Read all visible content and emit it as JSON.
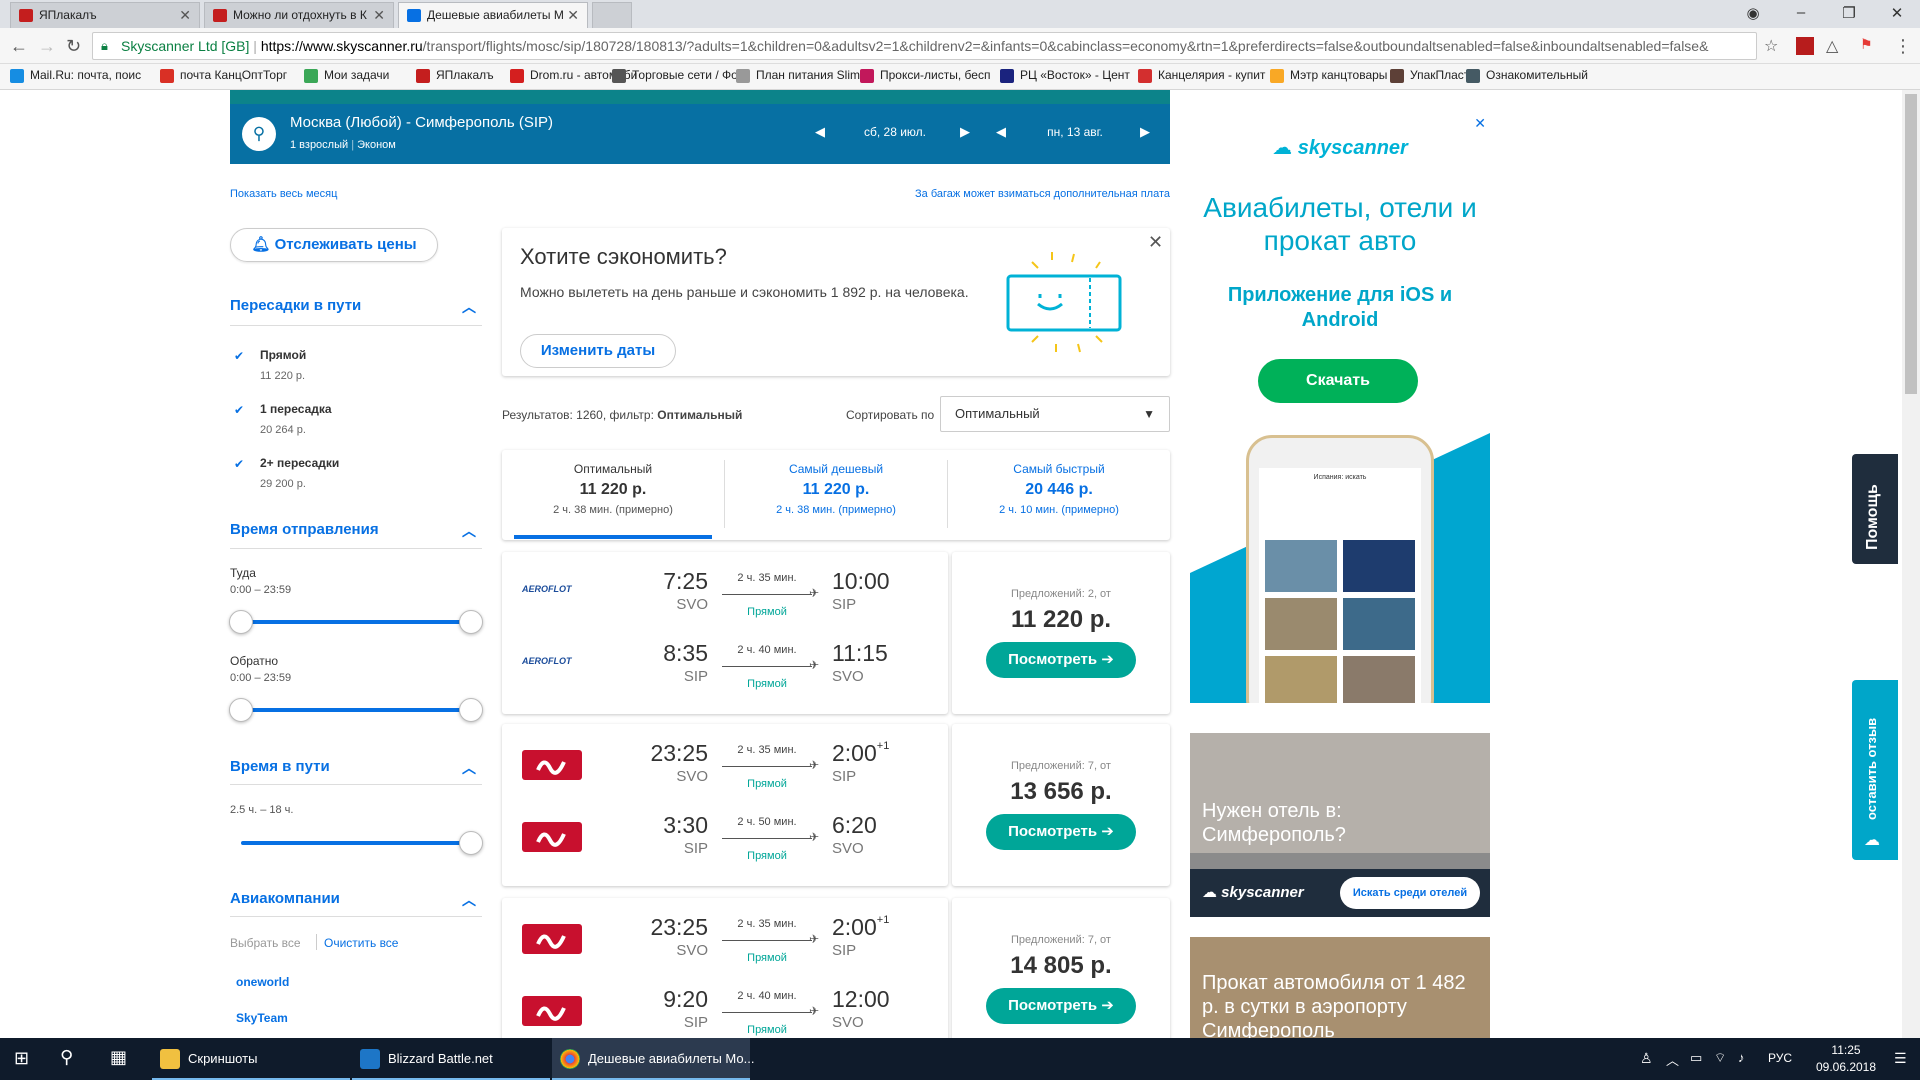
{
  "browser": {
    "tabs": [
      {
        "label": "ЯПлакалъ"
      },
      {
        "label": "Можно ли отдохнуть в К"
      },
      {
        "label": "Дешевые авиабилеты М"
      }
    ],
    "security_label": "Skyscanner Ltd [GB]",
    "url_domain": "https://www.skyscanner.ru",
    "url_path": "/transport/flights/mosc/sip/180728/180813/?adults=1&children=0&adultsv2=1&childrenv2=&infants=0&cabinclass=economy&rtn=1&preferdirects=false&outboundaltsenabled=false&inboundaltsenabled=false&",
    "bookmarks": [
      {
        "label": "Mail.Ru: почта, поис",
        "color": "#168de2"
      },
      {
        "label": "почта КанцОптТорг",
        "color": "#d93025"
      },
      {
        "label": "Мои задачи",
        "color": "#3aa757"
      },
      {
        "label": "ЯПлакалъ",
        "color": "#c41e1e"
      },
      {
        "label": "Drom.ru - автомоби",
        "color": "#d41f1f"
      },
      {
        "label": "Торговые сети / Фо",
        "color": "#555555"
      },
      {
        "label": "План питания Slim",
        "color": "#999999"
      },
      {
        "label": "Прокси-листы, бесп",
        "color": "#c2185b"
      },
      {
        "label": "РЦ «Восток» - Цент",
        "color": "#1a237e"
      },
      {
        "label": "Канцелярия - купит",
        "color": "#d32f2f"
      },
      {
        "label": "Мэтр канцтовары",
        "color": "#f9a825"
      },
      {
        "label": "УпакПласт",
        "color": "#5d4037"
      },
      {
        "label": "Ознакомительный",
        "color": "#455a64"
      }
    ]
  },
  "search": {
    "route": "Москва (Любой) - Симферополь (SIP)",
    "passengers": "1 взрослый",
    "cabin": "Эконом",
    "date_out": "сб, 28 июл.",
    "date_back": "пн, 13 авг.",
    "show_month": "Показать весь месяц",
    "baggage_note": "За багаж может взиматься дополнительная плата"
  },
  "filters": {
    "track_prices": "Отслеживать цены",
    "stops_title": "Пересадки в пути",
    "stops": [
      {
        "label": "Прямой",
        "price": "11 220 р."
      },
      {
        "label": "1 пересадка",
        "price": "20 264 р."
      },
      {
        "label": "2+ пересадки",
        "price": "29 200 р."
      }
    ],
    "departure_title": "Время отправления",
    "outbound_label": "Туда",
    "outbound_range": "0:00 – 23:59",
    "inbound_label": "Обратно",
    "inbound_range": "0:00 – 23:59",
    "duration_title": "Время в пути",
    "duration_range": "2.5 ч. – 18 ч.",
    "airlines_title": "Авиакомпании",
    "select_all": "Выбрать все",
    "clear_all": "Очистить все",
    "alliances": [
      "oneworld",
      "SkyTeam"
    ]
  },
  "promo": {
    "title": "Хотите сэкономить?",
    "text": "Можно вылететь на день раньше и сэкономить 1 892 р. на человека.",
    "button": "Изменить даты"
  },
  "results": {
    "count_prefix": "Результатов: 1260, фильтр: ",
    "count_filter": "Оптимальный",
    "sort_label": "Сортировать по",
    "sort_value": "Оптимальный",
    "tabs": [
      {
        "title": "Оптимальный",
        "price": "11 220 р.",
        "duration": "2 ч. 38 мин. (примерно)"
      },
      {
        "title": "Самый дешевый",
        "price": "11 220 р.",
        "duration": "2 ч. 38 мин. (примерно)"
      },
      {
        "title": "Самый быстрый",
        "price": "20 446 р.",
        "duration": "2 ч. 10 мин. (примерно)"
      }
    ],
    "flights": [
      {
        "airline": "AEROFLOT",
        "offers": "Предложений: 2, от",
        "price": "11 220 р.",
        "button": "Посмотреть",
        "legs": [
          {
            "dep": "7:25",
            "dep_apt": "SVO",
            "dur": "2 ч. 35 мин.",
            "type": "Прямой",
            "arr": "10:00",
            "arr_apt": "SIP",
            "plus": ""
          },
          {
            "dep": "8:35",
            "dep_apt": "SIP",
            "dur": "2 ч. 40 мин.",
            "type": "Прямой",
            "arr": "11:15",
            "arr_apt": "SVO",
            "plus": ""
          }
        ]
      },
      {
        "airline": "S7",
        "offers": "Предложений: 7, от",
        "price": "13 656 р.",
        "button": "Посмотреть",
        "legs": [
          {
            "dep": "23:25",
            "dep_apt": "SVO",
            "dur": "2 ч. 35 мин.",
            "type": "Прямой",
            "arr": "2:00",
            "arr_apt": "SIP",
            "plus": "+1"
          },
          {
            "dep": "3:30",
            "dep_apt": "SIP",
            "dur": "2 ч. 50 мин.",
            "type": "Прямой",
            "arr": "6:20",
            "arr_apt": "SVO",
            "plus": ""
          }
        ]
      },
      {
        "airline": "S7",
        "offers": "Предложений: 7, от",
        "price": "14 805 р.",
        "button": "Посмотреть",
        "legs": [
          {
            "dep": "23:25",
            "dep_apt": "SVO",
            "dur": "2 ч. 35 мин.",
            "type": "Прямой",
            "arr": "2:00",
            "arr_apt": "SIP",
            "plus": "+1"
          },
          {
            "dep": "9:20",
            "dep_apt": "SIP",
            "dur": "2 ч. 40 мин.",
            "type": "Прямой",
            "arr": "12:00",
            "arr_apt": "SVO",
            "plus": ""
          }
        ]
      }
    ]
  },
  "ads": {
    "brand": "skyscanner",
    "ad1_title": "Авиабилеты, отели и прокат авто",
    "ad1_sub": "Приложение для iOS и Android",
    "ad1_button": "Скачать",
    "phone_header": "Испания: искать",
    "ad2_title": "Нужен отель в: Симферополь?",
    "ad2_button": "Искать среди отелей",
    "ad3_title": "Прокат автомобиля от 1 482 р. в сутки в аэропорту Симферополь"
  },
  "side_tabs": {
    "help": "Помощь",
    "feedback": "оставить отзыв"
  },
  "taskbar": {
    "items": [
      {
        "label": "Скриншоты"
      },
      {
        "label": "Blizzard Battle.net"
      },
      {
        "label": "Дешевые авиабилеты Мо..."
      }
    ],
    "lang": "РУС",
    "time": "11:25",
    "date": "09.06.2018"
  },
  "colors": {
    "brand_blue": "#0770e3",
    "header_teal": "#0770a3",
    "green": "#00a698",
    "s7_red": "#c8102e"
  }
}
